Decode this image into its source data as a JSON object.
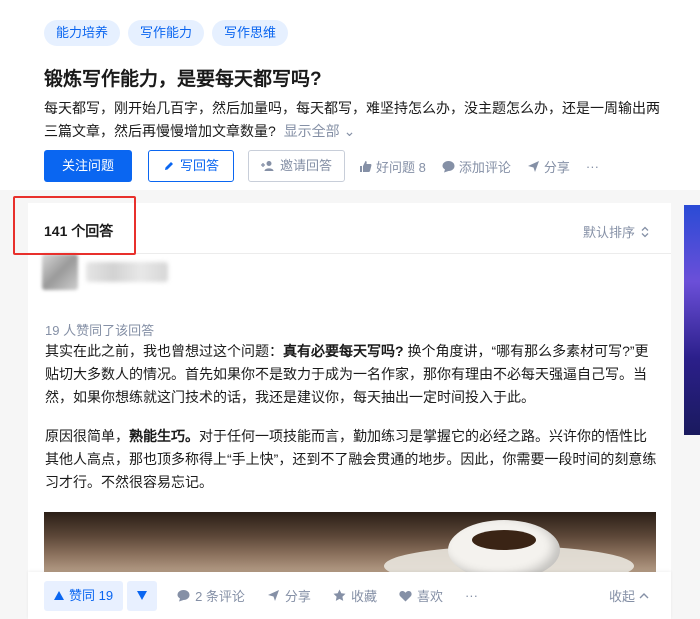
{
  "tags": [
    "能力培养",
    "写作能力",
    "写作思维"
  ],
  "question": {
    "title": "锻炼写作能力，是要每天都写吗?",
    "detail_line1": "每天都写，刚开始几百字，然后加量吗，每天都写，难坚持怎么办，没主题怎么办，还是一周输出两",
    "detail_line2": "三篇文章，然后再慢慢增加文章数量?",
    "show_all": "显示全部"
  },
  "actions": {
    "follow": "关注问题",
    "write_answer": "写回答",
    "invite": "邀请回答",
    "good_question": "好问题 8",
    "add_comment": "添加评论",
    "share": "分享",
    "more": "···"
  },
  "answers": {
    "count_label": "141 个回答",
    "sort_label": "默认排序"
  },
  "answer": {
    "upvote_info": "19 人赞同了该回答",
    "p1_a": "其实在此之前，我也曾想过这个问题：",
    "p1_b": "真有必要每天写吗?",
    "p1_c": " 换个角度讲，“哪有那么多素材可写?”更贴切大多数人的情况。首先如果你不是致力于成为一名作家，那你有理由不必每天强逼自己写。当然，如果你想练就这门技术的话，我还是建议你，每天抽出一定时间投入于此。",
    "p2_a": "原因很简单，",
    "p2_b": "熟能生巧。",
    "p2_c": "对于任何一项技能而言，勤加练习是掌握它的必经之路。兴许你的悟性比其他人高点，那也顶多称得上“手上快”，还到不了融会贯通的地步。因此，你需要一段时间的刻意练习才行。不然很容易忘记。"
  },
  "bottom": {
    "upvote": "赞同 19",
    "comments": "2 条评论",
    "share": "分享",
    "favorite": "收藏",
    "like": "喜欢",
    "more": "···",
    "collapse": "收起"
  },
  "colors": {
    "brand_blue": "#0a66f1",
    "highlight_red": "#e8302c",
    "muted_gray": "#8590a6"
  }
}
